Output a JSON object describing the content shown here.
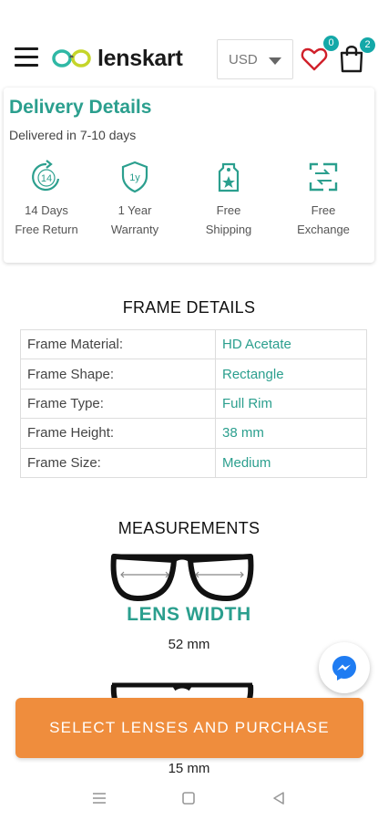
{
  "header": {
    "brand": "lenskart",
    "currency": "USD",
    "wishlist_count": "0",
    "cart_count": "2"
  },
  "delivery": {
    "title": "Delivery Details",
    "subtitle": "Delivered in 7-10 days",
    "features": [
      {
        "icon": "return-14-days-icon",
        "line1": "14 Days",
        "line2": "Free Return",
        "badge": "14"
      },
      {
        "icon": "warranty-shield-icon",
        "line1": "1 Year",
        "line2": "Warranty",
        "badge": "1y"
      },
      {
        "icon": "shipping-tag-icon",
        "line1": "Free",
        "line2": "Shipping"
      },
      {
        "icon": "exchange-arrows-icon",
        "line1": "Free",
        "line2": "Exchange"
      }
    ]
  },
  "frame_details": {
    "title": "FRAME DETAILS",
    "rows": [
      {
        "label": "Frame Material:",
        "value": "HD Acetate"
      },
      {
        "label": "Frame Shape:",
        "value": "Rectangle"
      },
      {
        "label": "Frame Type:",
        "value": "Full Rim"
      },
      {
        "label": "Frame Height:",
        "value": "38 mm"
      },
      {
        "label": "Frame Size:",
        "value": "Medium"
      }
    ]
  },
  "measurements": {
    "title": "MEASUREMENTS",
    "items": [
      {
        "label": "LENS WIDTH",
        "value": "52 mm"
      },
      {
        "label": "",
        "value": "15 mm"
      }
    ]
  },
  "cta": {
    "label": "SELECT LENSES AND PURCHASE"
  },
  "colors": {
    "accent": "#2b9f8e",
    "cta": "#ef8d3d",
    "badge": "#14a8a8"
  }
}
